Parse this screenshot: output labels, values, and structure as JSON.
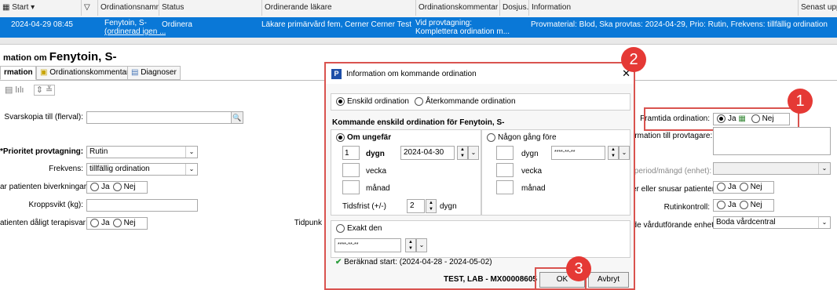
{
  "list": {
    "headers": {
      "start": "Start",
      "name": "Ordinationsnamn",
      "status": "Status",
      "doctor": "Ordinerande läkare",
      "comment": "Ordinationskommentar",
      "dosage": "Dosjus...",
      "info": "Information",
      "last": "Senast upp"
    },
    "row": {
      "start": "2024-04-29 08:45",
      "name1": "Fenytoin, S-",
      "name2": "(ordinerad igen ...",
      "status": "Ordinera",
      "doctor": "Läkare primärvård fem, Cerner Cerner Test",
      "comment1": "Vid provtagning:",
      "comment2": "Komplettera ordination m...",
      "info": "Provmaterial: Blod, Ska provtas: 2024-04-29, Prio: Rutin, Frekvens: tillfällig ordination"
    }
  },
  "page": {
    "title_prefix": "mation om",
    "title_name": "Fenytoin, S-",
    "tabs": {
      "info": "rmation",
      "comment": "Ordinationskommentar",
      "diag": "Diagnoser"
    }
  },
  "form": {
    "svarskopia_label": "Svarskopia till (flerval):",
    "prioritet_label": "*Prioritet provtagning:",
    "prioritet_value": "Rutin",
    "frekvens_label": "Frekvens:",
    "frekvens_value": "tillfällig ordination",
    "biverkningar_label": "ar patienten biverkningar:",
    "kroppsvikt_label": "Kroppsvikt (kg):",
    "terapisvar_label": "atienten dåligt terapisvar:",
    "tidpunkt_label": "Tidpunk",
    "ja": "Ja",
    "nej": "Nej",
    "framtida_label": "Framtida ordination:",
    "info_provtagare_label": "formation till provtagare:",
    "dosperiod_label": "diperiod/mängd (enhet):",
    "snusar_label": "ker eller snusar patienten:",
    "rutinkontroll_label": "Rutinkontroll:",
    "vardenhet_label": "nde vårdutförande enhet:",
    "vardenhet_value": "Boda vårdcentral"
  },
  "dialog": {
    "title": "Information om kommande ordination",
    "enskild": "Enskild ordination",
    "aterkommande": "Återkommande ordination",
    "section_title": "Kommande enskild ordination för Fenytoin, S-",
    "om_ungefar": "Om ungefär",
    "nagon_gang": "Någon gång före",
    "dygn_value": "1",
    "dygn": "dygn",
    "vecka": "vecka",
    "manad": "månad",
    "date_value": "2024-04-30",
    "date_placeholder": "****-**-**",
    "tidsfrist_label": "Tidsfrist (+/-)",
    "tidsfrist_value": "2",
    "exakt": "Exakt den",
    "beraknad": "Beräknad start: (2024-04-28 - 2024-05-02)",
    "user": "TEST, LAB - MX00008605",
    "ok": "OK",
    "avbryt": "Avbryt"
  },
  "badges": {
    "one": "1",
    "two": "2",
    "three": "3"
  },
  "colors": {
    "selected_row": "#0a78d7",
    "highlight": "#d9534f",
    "badge": "#e53935"
  }
}
